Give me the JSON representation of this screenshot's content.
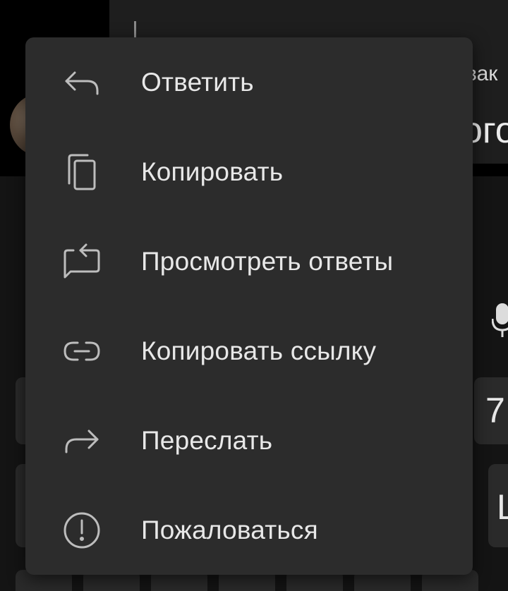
{
  "background": {
    "header_snippet_small": "вак",
    "header_snippet_large": "ого",
    "keyboard_key_label_1": "7",
    "keyboard_key_label_2": "Ц"
  },
  "context_menu": {
    "items": [
      {
        "label": "Ответить",
        "icon": "reply-icon"
      },
      {
        "label": "Копировать",
        "icon": "copy-icon"
      },
      {
        "label": "Просмотреть ответы",
        "icon": "view-replies-icon"
      },
      {
        "label": "Копировать ссылку",
        "icon": "link-icon"
      },
      {
        "label": "Переслать",
        "icon": "forward-icon"
      },
      {
        "label": "Пожаловаться",
        "icon": "report-icon"
      }
    ]
  },
  "colors": {
    "menu_background": "#2c2c2c",
    "menu_text": "#e8e8e8",
    "icon_stroke": "#bdbdbd",
    "page_background": "#000000"
  }
}
